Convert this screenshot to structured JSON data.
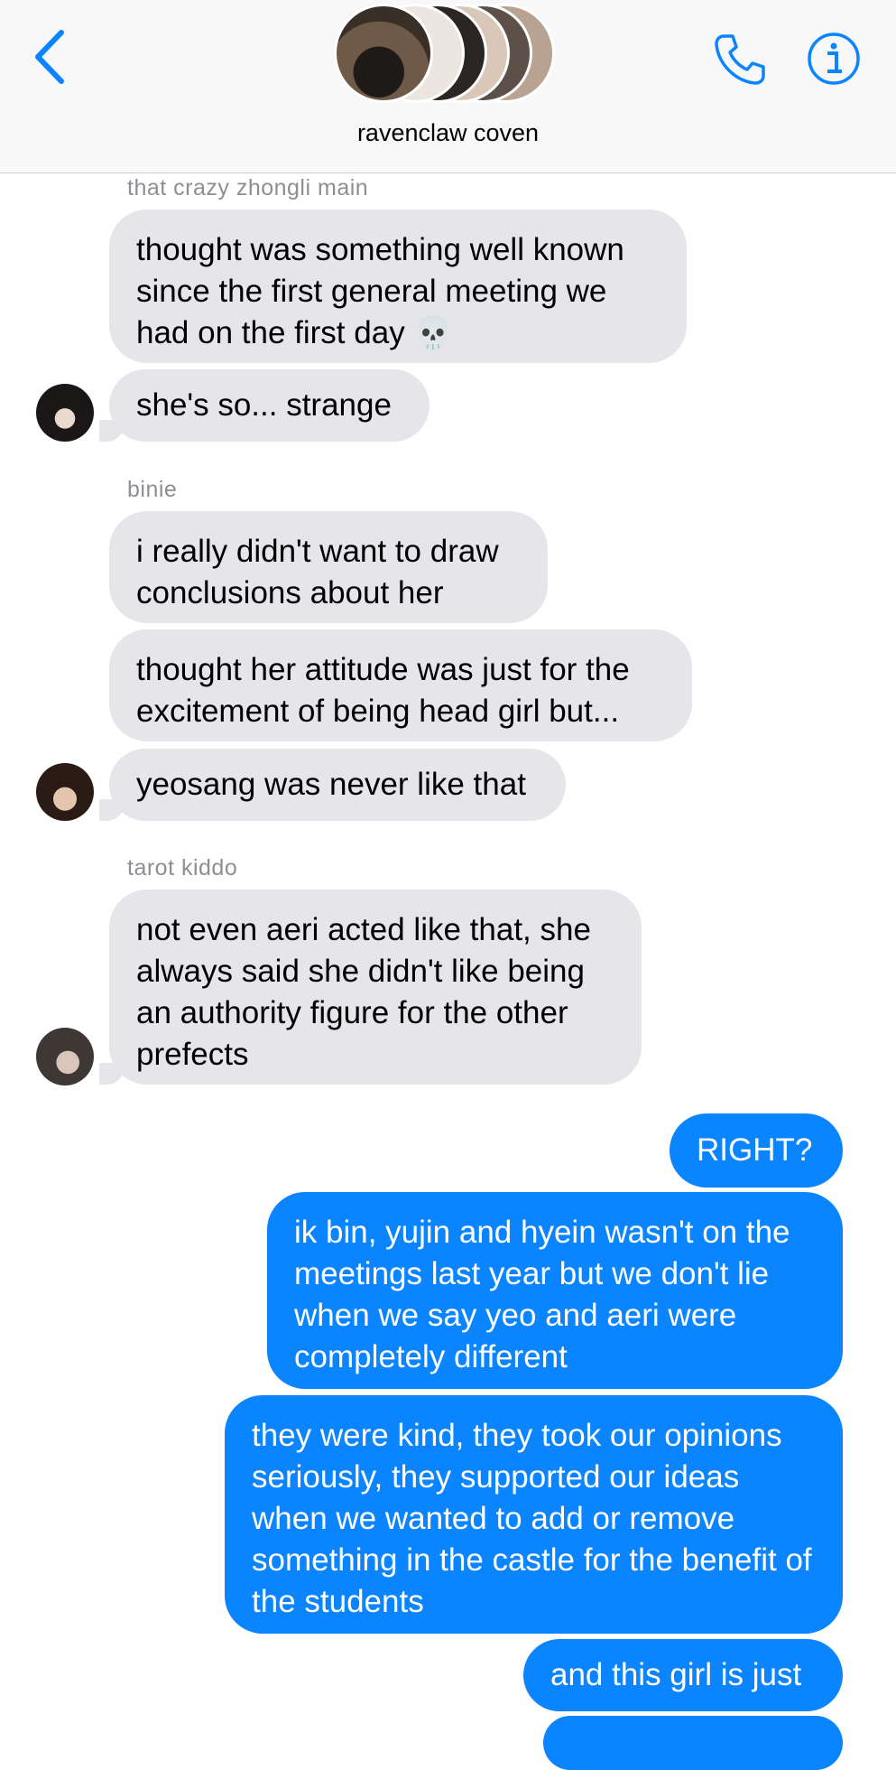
{
  "header": {
    "group_name": "ravenclaw coven",
    "accent_color": "#0b84ff",
    "icons": [
      "chevron-left-icon",
      "phone-icon",
      "info-icon"
    ]
  },
  "messages": [
    {
      "sender": "that crazy zhongli main",
      "bubbles": [
        "thought was something well known since the first general meeting we had on the first day 💀",
        "she's so... strange"
      ]
    },
    {
      "sender": "binie",
      "bubbles": [
        "i really didn't want to draw conclusions about her",
        "thought her attitude was just for the excitement of being head girl but...",
        "yeosang was never like that"
      ]
    },
    {
      "sender": "tarot kiddo",
      "bubbles": [
        "not even aeri acted like that, she always said she didn't like being an authority figure for the other prefects"
      ]
    }
  ],
  "outgoing": [
    "RIGHT?",
    "ik bin, yujin and hyein wasn't on the meetings last year but we don't lie when we say yeo and aeri were completely different",
    "they were kind, they took our opinions seriously, they supported our ideas when we wanted to add or remove something in the castle for the benefit of the students",
    "and this girl is just"
  ],
  "colors": {
    "incoming_bubble": "#e5e5ea",
    "outgoing_bubble": "#0b84ff",
    "sender_name": "#8e8e93"
  }
}
